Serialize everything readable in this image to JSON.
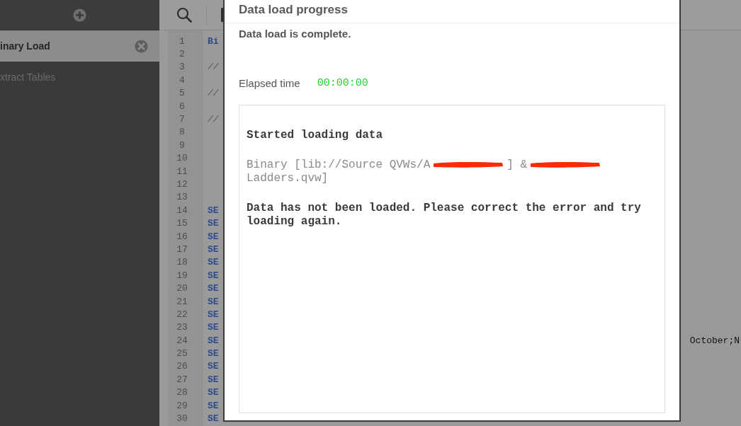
{
  "sidebar": {
    "items": [
      {
        "label": "inary Load",
        "selected": true
      },
      {
        "label": "xtract Tables",
        "selected": false
      }
    ]
  },
  "editor": {
    "lines": [
      {
        "number": "1",
        "kind": "keyword",
        "code": "Bi"
      },
      {
        "number": "2"
      },
      {
        "number": "3",
        "kind": "comment",
        "code": "//"
      },
      {
        "number": "4"
      },
      {
        "number": "5",
        "kind": "comment",
        "code": "//"
      },
      {
        "number": "6"
      },
      {
        "number": "7",
        "kind": "comment",
        "code": "//"
      },
      {
        "number": "8"
      },
      {
        "number": "9"
      },
      {
        "number": "10"
      },
      {
        "number": "11"
      },
      {
        "number": "12"
      },
      {
        "number": "13"
      },
      {
        "number": "14",
        "kind": "keyword",
        "code": "SE"
      },
      {
        "number": "15",
        "kind": "keyword",
        "code": "SE"
      },
      {
        "number": "16",
        "kind": "keyword",
        "code": "SE"
      },
      {
        "number": "17",
        "kind": "keyword",
        "code": "SE"
      },
      {
        "number": "18",
        "kind": "keyword",
        "code": "SE"
      },
      {
        "number": "19",
        "kind": "keyword",
        "code": "SE"
      },
      {
        "number": "20",
        "kind": "keyword",
        "code": "SE"
      },
      {
        "number": "21",
        "kind": "keyword",
        "code": "SE"
      },
      {
        "number": "22",
        "kind": "keyword",
        "code": "SE"
      },
      {
        "number": "23",
        "kind": "keyword",
        "code": "SE"
      },
      {
        "number": "24",
        "kind": "keyword",
        "code": "SE",
        "tail": "October;N"
      },
      {
        "number": "25",
        "kind": "keyword",
        "code": "SE"
      },
      {
        "number": "26",
        "kind": "keyword",
        "code": "SE"
      },
      {
        "number": "27",
        "kind": "keyword",
        "code": "SE"
      },
      {
        "number": "28",
        "kind": "keyword",
        "code": "SE"
      },
      {
        "number": "29",
        "kind": "keyword",
        "code": "SE"
      },
      {
        "number": "30",
        "kind": "keyword",
        "code": "SE"
      }
    ]
  },
  "dialog": {
    "title": "Data load progress",
    "status": "Data load is complete.",
    "elapsed_label": "Elapsed time",
    "elapsed_value": "00:00:00",
    "log": [
      {
        "kind": "heading",
        "text": "Started loading data"
      },
      {
        "kind": "command",
        "parts": [
          {
            "kind": "text",
            "text": "Binary [lib://Source QVWs/A"
          },
          {
            "kind": "redacted"
          },
          {
            "kind": "text",
            "text": "] &"
          },
          {
            "kind": "redacted"
          },
          {
            "kind": "text",
            "text": "Ladders.qvw]"
          }
        ]
      },
      {
        "kind": "error",
        "text": "Data has not been loaded. Please correct the error and try loading again."
      }
    ]
  }
}
